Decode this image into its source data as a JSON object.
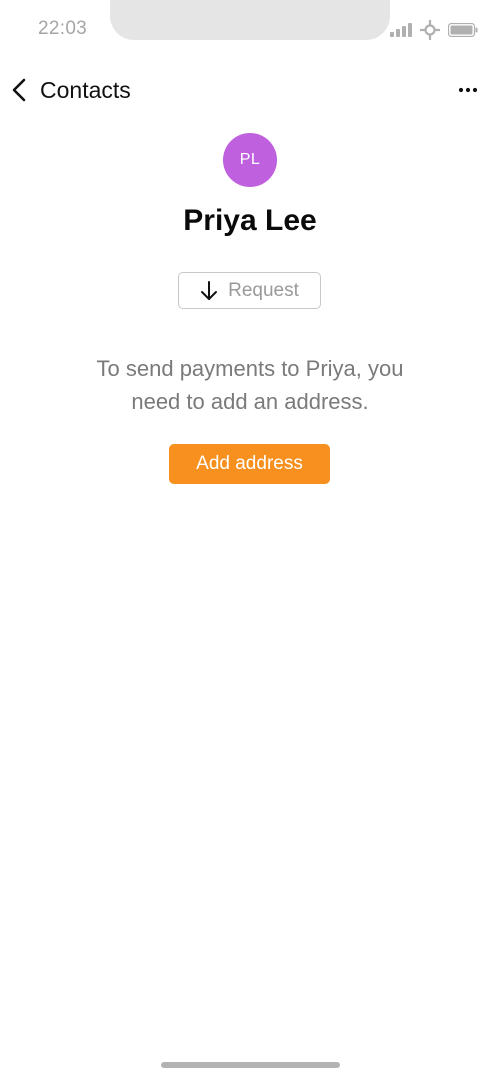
{
  "status_bar": {
    "time": "22:03",
    "icons": [
      "signal-icon",
      "wifi-icon",
      "battery-icon"
    ]
  },
  "nav": {
    "back_label": "Contacts",
    "back_icon": "chevron-left-icon",
    "more_icon": "more-horizontal-icon"
  },
  "contact": {
    "initials": "PL",
    "name": "Priya Lee",
    "avatar_color": "#bf60de"
  },
  "actions": {
    "request_label": "Request",
    "request_icon": "arrow-down-icon",
    "add_address_label": "Add address",
    "add_address_color": "#f7901e"
  },
  "message": {
    "line1": "To send payments to Priya, you",
    "line2": "need to add an address."
  }
}
